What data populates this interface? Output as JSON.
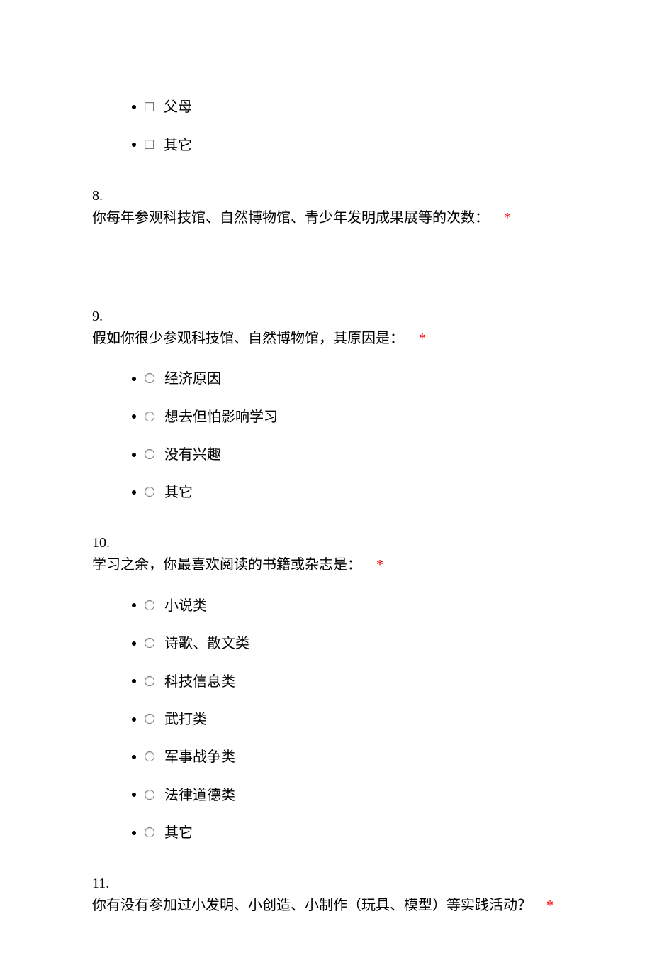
{
  "required_mark": "*",
  "q7_tail": {
    "options": [
      {
        "label": "父母",
        "kind": "checkbox"
      },
      {
        "label": "其它",
        "kind": "checkbox"
      }
    ]
  },
  "q8": {
    "number": "8.",
    "text": "你每年参观科技馆、自然博物馆、青少年发明成果展等的次数：",
    "required": true
  },
  "q9": {
    "number": "9.",
    "text": "假如你很少参观科技馆、自然博物馆，其原因是：",
    "required": true,
    "options": [
      {
        "label": "经济原因"
      },
      {
        "label": "想去但怕影响学习"
      },
      {
        "label": "没有兴趣"
      },
      {
        "label": "其它"
      }
    ]
  },
  "q10": {
    "number": "10.",
    "text": "学习之余，你最喜欢阅读的书籍或杂志是：",
    "required": true,
    "options": [
      {
        "label": "小说类"
      },
      {
        "label": "诗歌、散文类"
      },
      {
        "label": "科技信息类"
      },
      {
        "label": "武打类"
      },
      {
        "label": "军事战争类"
      },
      {
        "label": "法律道德类"
      },
      {
        "label": "其它"
      }
    ]
  },
  "q11": {
    "number": "11.",
    "text": "你有没有参加过小发明、小创造、小制作（玩具、模型）等实践活动？",
    "required": true
  }
}
